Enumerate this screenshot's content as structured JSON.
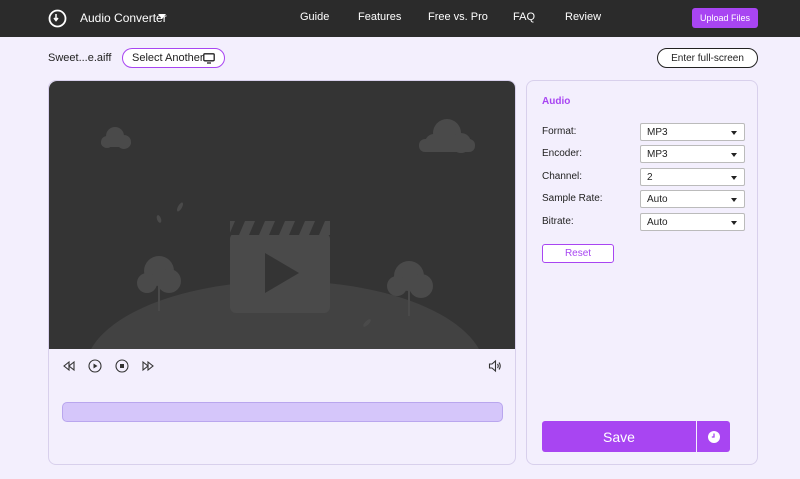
{
  "header": {
    "app_title": "Audio Converter",
    "nav": [
      "Guide",
      "Features",
      "Free vs. Pro",
      "FAQ",
      "Review"
    ],
    "upload_label": "Upload Files"
  },
  "file": {
    "name": "Sweet...e.aiff",
    "select_another_label": "Select Another",
    "fullscreen_label": "Enter full-screen"
  },
  "player": {
    "controls": [
      "rewind-icon",
      "play-icon",
      "stop-icon",
      "fast-forward-icon",
      "volume-icon"
    ]
  },
  "settings": {
    "title": "Audio",
    "fields": [
      {
        "label": "Format:",
        "value": "MP3"
      },
      {
        "label": "Encoder:",
        "value": "MP3"
      },
      {
        "label": "Channel:",
        "value": "2"
      },
      {
        "label": "Sample Rate:",
        "value": "Auto"
      },
      {
        "label": "Bitrate:",
        "value": "Auto"
      }
    ],
    "reset_label": "Reset",
    "save_label": "Save"
  },
  "colors": {
    "accent": "#a845f2",
    "topbar": "#2b2b2b",
    "background": "#f3effd",
    "video_bg": "#343434"
  }
}
